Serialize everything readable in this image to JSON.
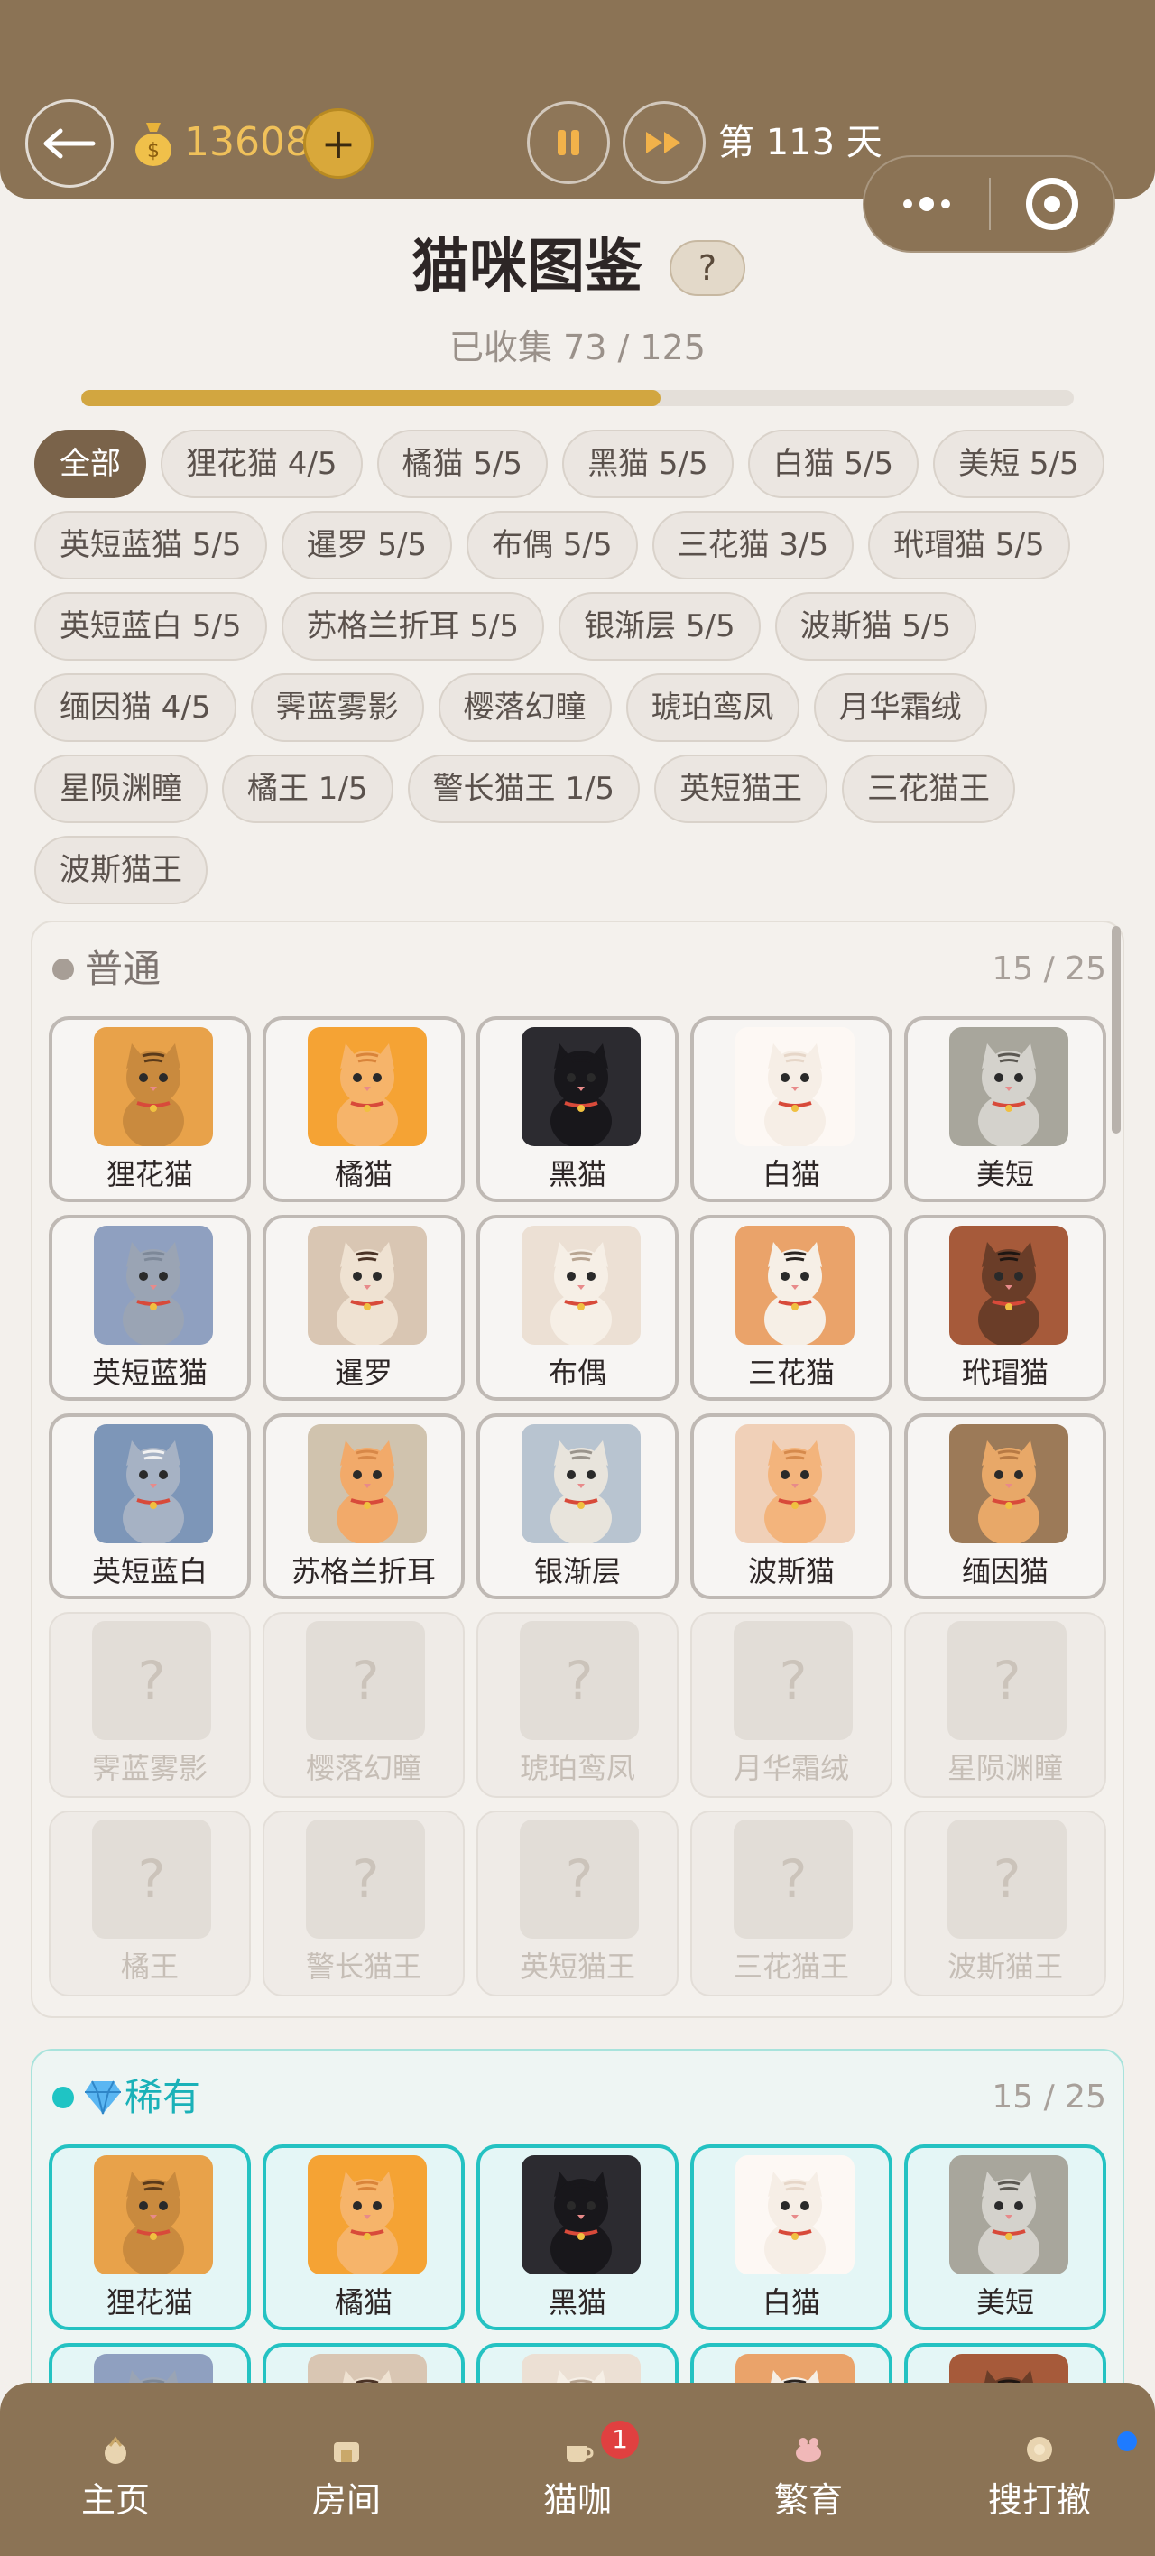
{
  "header": {
    "coins": "13608",
    "plus_label": "+",
    "day_label": "第 113 天"
  },
  "page": {
    "title": "猫咪图鉴",
    "help_label": "?",
    "collected_text": "已收集 73 / 125",
    "progress_fraction": 0.584
  },
  "filters": [
    {
      "label": "全部",
      "active": true
    },
    {
      "label": "狸花猫 4/5"
    },
    {
      "label": "橘猫 5/5"
    },
    {
      "label": "黑猫 5/5"
    },
    {
      "label": "白猫 5/5"
    },
    {
      "label": "美短 5/5"
    },
    {
      "label": "英短蓝猫 5/5"
    },
    {
      "label": "暹罗 5/5"
    },
    {
      "label": "布偶 5/5"
    },
    {
      "label": "三花猫 3/5"
    },
    {
      "label": "玳瑁猫 5/5"
    },
    {
      "label": "英短蓝白 5/5"
    },
    {
      "label": "苏格兰折耳 5/5"
    },
    {
      "label": "银渐层 5/5"
    },
    {
      "label": "波斯猫 5/5"
    },
    {
      "label": "缅因猫 4/5"
    },
    {
      "label": "霁蓝雾影"
    },
    {
      "label": "樱落幻瞳"
    },
    {
      "label": "琥珀鸾凤"
    },
    {
      "label": "月华霜绒"
    },
    {
      "label": "星陨渊瞳"
    },
    {
      "label": "橘王 1/5"
    },
    {
      "label": "警长猫王 1/5"
    },
    {
      "label": "英短猫王"
    },
    {
      "label": "三花猫王"
    },
    {
      "label": "波斯猫王"
    }
  ],
  "sections": [
    {
      "title": "普通",
      "count": "15 / 25",
      "cats": [
        {
          "name": "狸花猫",
          "unlocked": true,
          "bg": "#e8a24a",
          "fur": "#c98a3e",
          "stripe": "#5a3a1a"
        },
        {
          "name": "橘猫",
          "unlocked": true,
          "bg": "#f5a334",
          "fur": "#f6b46a",
          "stripe": "#d9843a"
        },
        {
          "name": "黑猫",
          "unlocked": true,
          "bg": "#2c2b30",
          "fur": "#18171b",
          "stripe": "#18171b"
        },
        {
          "name": "白猫",
          "unlocked": true,
          "bg": "#fdf8f4",
          "fur": "#f6eee6",
          "stripe": "#e6d6c8"
        },
        {
          "name": "美短",
          "unlocked": true,
          "bg": "#a8a69c",
          "fur": "#d4d2cc",
          "stripe": "#5b5852"
        },
        {
          "name": "英短蓝猫",
          "unlocked": true,
          "bg": "#8fa0c0",
          "fur": "#9aa4b4",
          "stripe": "#7d8898"
        },
        {
          "name": "暹罗",
          "unlocked": true,
          "bg": "#d9c6b3",
          "fur": "#efe2d2",
          "stripe": "#4a3326"
        },
        {
          "name": "布偶",
          "unlocked": true,
          "bg": "#ece0d4",
          "fur": "#f6efe6",
          "stripe": "#b8a592"
        },
        {
          "name": "三花猫",
          "unlocked": true,
          "bg": "#eaa36a",
          "fur": "#f6efe6",
          "stripe": "#2a2420"
        },
        {
          "name": "玳瑁猫",
          "unlocked": true,
          "bg": "#a65a3a",
          "fur": "#6a3d28",
          "stripe": "#1e1612"
        },
        {
          "name": "英短蓝白",
          "unlocked": true,
          "bg": "#7d96b8",
          "fur": "#a6b2c4",
          "stripe": "#f2f2f2"
        },
        {
          "name": "苏格兰折耳",
          "unlocked": true,
          "bg": "#d0c3ae",
          "fur": "#f2aa6a",
          "stripe": "#d88848"
        },
        {
          "name": "银渐层",
          "unlocked": true,
          "bg": "#b8c4d0",
          "fur": "#e8e4dc",
          "stripe": "#9a948c"
        },
        {
          "name": "波斯猫",
          "unlocked": true,
          "bg": "#f0d0b8",
          "fur": "#f3b47c",
          "stripe": "#d68a4c"
        },
        {
          "name": "缅因猫",
          "unlocked": true,
          "bg": "#9c7a58",
          "fur": "#e8a868",
          "stripe": "#b87a44"
        },
        {
          "name": "霁蓝雾影",
          "unlocked": false
        },
        {
          "name": "樱落幻瞳",
          "unlocked": false
        },
        {
          "name": "琥珀鸾凤",
          "unlocked": false
        },
        {
          "name": "月华霜绒",
          "unlocked": false
        },
        {
          "name": "星陨渊瞳",
          "unlocked": false
        },
        {
          "name": "橘王",
          "unlocked": false
        },
        {
          "name": "警长猫王",
          "unlocked": false
        },
        {
          "name": "英短猫王",
          "unlocked": false
        },
        {
          "name": "三花猫王",
          "unlocked": false
        },
        {
          "name": "波斯猫王",
          "unlocked": false
        }
      ]
    },
    {
      "title": "稀有",
      "count": "15 / 25",
      "cats": [
        {
          "name": "狸花猫",
          "unlocked": true,
          "bg": "#e8a24a",
          "fur": "#c98a3e",
          "stripe": "#5a3a1a"
        },
        {
          "name": "橘猫",
          "unlocked": true,
          "bg": "#f5a334",
          "fur": "#f6b46a",
          "stripe": "#d9843a"
        },
        {
          "name": "黑猫",
          "unlocked": true,
          "bg": "#2c2b30",
          "fur": "#18171b",
          "stripe": "#18171b"
        },
        {
          "name": "白猫",
          "unlocked": true,
          "bg": "#fdf8f4",
          "fur": "#f6eee6",
          "stripe": "#e6d6c8"
        },
        {
          "name": "美短",
          "unlocked": true,
          "bg": "#a8a69c",
          "fur": "#d4d2cc",
          "stripe": "#5b5852"
        },
        {
          "name": "",
          "unlocked": true,
          "bg": "#8fa0c0",
          "fur": "#9aa4b4",
          "stripe": "#7d8898"
        },
        {
          "name": "",
          "unlocked": true,
          "bg": "#d9c6b3",
          "fur": "#efe2d2",
          "stripe": "#4a3326"
        },
        {
          "name": "",
          "unlocked": true,
          "bg": "#ece0d4",
          "fur": "#f6efe6",
          "stripe": "#b8a592"
        },
        {
          "name": "",
          "unlocked": true,
          "bg": "#eaa36a",
          "fur": "#f6efe6",
          "stripe": "#2a2420"
        },
        {
          "name": "",
          "unlocked": true,
          "bg": "#a65a3a",
          "fur": "#6a3d28",
          "stripe": "#1e1612"
        }
      ]
    }
  ],
  "nav": [
    {
      "label": "主页",
      "icon": "home-icon"
    },
    {
      "label": "房间",
      "icon": "room-icon"
    },
    {
      "label": "猫咖",
      "icon": "cafe-icon",
      "badge": "1"
    },
    {
      "label": "繁育",
      "icon": "breed-icon"
    },
    {
      "label": "搜打撤",
      "icon": "explore-icon",
      "dot": true
    }
  ]
}
